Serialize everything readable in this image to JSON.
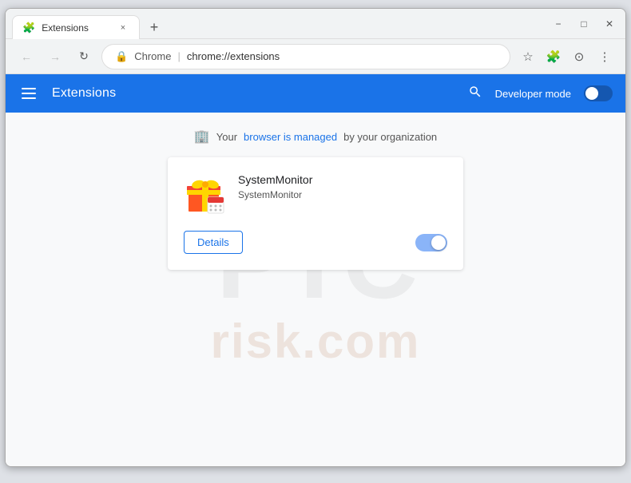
{
  "window": {
    "title": "Extensions",
    "minimize_label": "−",
    "maximize_label": "□",
    "close_label": "✕"
  },
  "tab": {
    "label": "Extensions",
    "icon": "🧩",
    "close": "×"
  },
  "new_tab_btn": "+",
  "addressbar": {
    "back_icon": "←",
    "forward_icon": "→",
    "refresh_icon": "↻",
    "chrome_label": "Chrome",
    "separator": "|",
    "url": "chrome://extensions",
    "bookmark_icon": "☆",
    "extensions_icon": "🧩",
    "profile_icon": "⊙",
    "menu_icon": "⋮"
  },
  "extensions_page": {
    "header": {
      "title": "Extensions",
      "search_icon": "search",
      "developer_mode_label": "Developer mode",
      "toggle_on": false
    },
    "managed_notice": {
      "icon": "🏢",
      "text_before": "Your",
      "link_text": "browser is managed",
      "text_after": "by your organization"
    },
    "extension": {
      "name": "SystemMonitor",
      "description": "SystemMonitor",
      "details_label": "Details",
      "enabled": true
    }
  },
  "watermark": {
    "top": "PTC",
    "bottom": "risk.com"
  }
}
